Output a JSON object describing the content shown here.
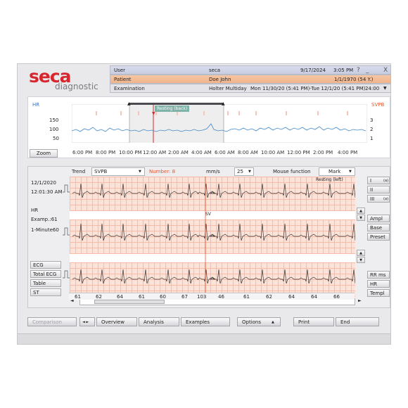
{
  "brand": {
    "name": "seca",
    "product": "diagnostic"
  },
  "header": {
    "user": {
      "label": "User",
      "value": "seca",
      "date": "9/17/2024",
      "time": "3:05 PM"
    },
    "patient": {
      "label": "Patient",
      "value": "Doe John",
      "dob": "1/1/1970 (54 Y.)"
    },
    "exam": {
      "label": "Examination",
      "type": "Holter  Multiday",
      "range": "Mon 11/30/20 (5:41 PM)-Tue 12/1/20 (5:41 PM)",
      "duration": "24:00"
    }
  },
  "window_controls": {
    "help": "?",
    "minimize": "_",
    "close": "X"
  },
  "hr_panel": {
    "left_label": "HR",
    "right_label": "SVPB",
    "marker_label": "Resting (back)",
    "y_ticks": [
      "150",
      "100",
      "50"
    ],
    "right_ticks": [
      "3",
      "2",
      "1"
    ],
    "x_ticks": [
      "6:00 PM",
      "8:00 PM",
      "10:00 PM",
      "12:00 AM",
      "2:00 AM",
      "4:00 AM",
      "6:00 AM",
      "8:00 AM",
      "10:00 AM",
      "12:00 PM",
      "2:00 PM",
      "4:00 PM"
    ],
    "zoom_label": "Zoom"
  },
  "ecg_toolbar": {
    "trend_label": "Trend",
    "trend_value": "SVPB",
    "number_label": "Number: 8",
    "speed_label": "mm/s",
    "speed_value": "25",
    "mouse_label": "Mouse function",
    "mouse_value": "Mark",
    "resting_label": "Resting (left)"
  },
  "ecg_side": {
    "date": "12/1/2020",
    "time": "12:01:30 AM",
    "hr_label": "HR",
    "examp": "Examp.:61",
    "minute": "1-Minute60"
  },
  "ecg_leads": [
    "I",
    "II",
    "III"
  ],
  "lead_marks": [
    "(a)",
    "(a)"
  ],
  "sv_label": "SV",
  "right_buttons": {
    "ampl": "Ampl",
    "base": "Base",
    "preset": "Preset",
    "rr": "RR ms",
    "hr": "HR",
    "templ": "Templ"
  },
  "left_buttons": {
    "ecg": "ECG",
    "total": "Total ECG",
    "table": "Table",
    "st": "ST"
  },
  "hr_values": [
    "61",
    "62",
    "64",
    "61",
    "60",
    "67",
    "103",
    "46",
    "61",
    "62",
    "64",
    "64",
    "66"
  ],
  "bottom_bar": {
    "comparison": "Comparison",
    "overview": "Overview",
    "analysis": "Analysis",
    "examples": "Examples",
    "options": "Options",
    "print": "Print",
    "end": "End"
  },
  "colors": {
    "brand_red": "#d7262d",
    "ecg_grid": "#fde2d8",
    "marker": "#e4542a",
    "hr_line": "#3f88c9",
    "patient_row": "#f0b48c"
  }
}
